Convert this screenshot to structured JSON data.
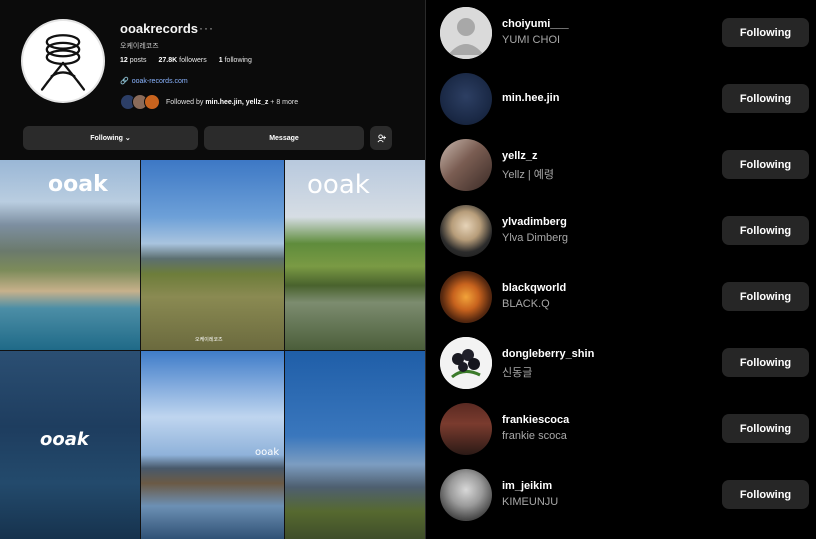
{
  "profile": {
    "username": "ooakrecords",
    "more_icon": "ellipsis-icon",
    "full_name": "오케이레코즈",
    "posts_count": "12",
    "posts_label": "posts",
    "followers_count": "27.8K",
    "followers_label": "followers",
    "following_count": "1",
    "following_label": "following",
    "link": "ooak-records.com",
    "followed_by_prefix": "Followed by",
    "followed_by_names": "min.hee.jin, yellz_z",
    "followed_by_more": "+ 8 more"
  },
  "actions": {
    "following_label": "Following",
    "message_label": "Message",
    "add_person_icon": "add-person-icon"
  },
  "posts": [
    {
      "watermark": "ooak"
    },
    {
      "caption": "오케이레코즈"
    },
    {
      "watermark": "ooak"
    },
    {
      "watermark": "ooak"
    },
    {
      "watermark": "ooak"
    },
    {
      "watermark": ""
    }
  ],
  "following_list": [
    {
      "username": "choiyumi___",
      "name": "YUMI CHOI",
      "button": "Following"
    },
    {
      "username": "min.hee.jin",
      "name": "",
      "button": "Following"
    },
    {
      "username": "yellz_z",
      "name": "Yellz | 예령",
      "button": "Following"
    },
    {
      "username": "ylvadimberg",
      "name": "Ylva Dimberg",
      "button": "Following"
    },
    {
      "username": "blackqworld",
      "name": "BLACK.Q",
      "button": "Following"
    },
    {
      "username": "dongleberry_shin",
      "name": "신동글",
      "button": "Following"
    },
    {
      "username": "frankiescoca",
      "name": "frankie scoca",
      "button": "Following"
    },
    {
      "username": "im_jeikim",
      "name": "KIMEUNJU",
      "button": "Following"
    }
  ],
  "colors": {
    "background": "#000000",
    "button": "#262626",
    "link": "#8ab4ff",
    "secondary_text": "#a8a8a8"
  }
}
